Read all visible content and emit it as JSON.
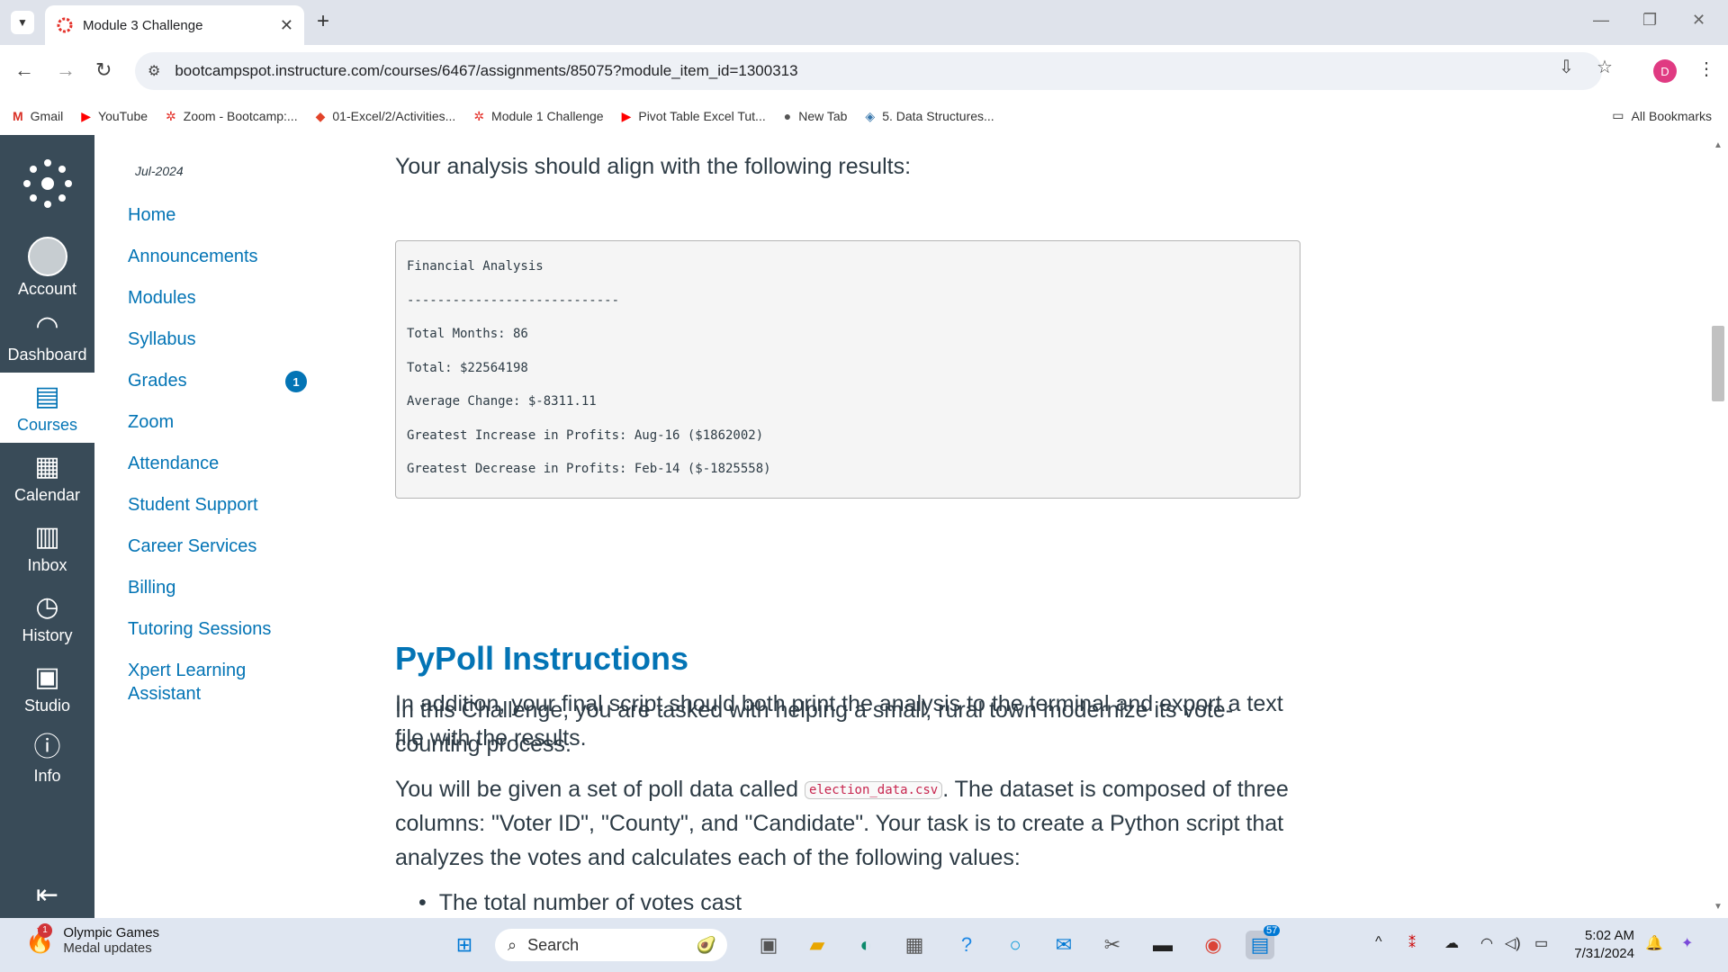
{
  "browser": {
    "tab_title": "Module 3 Challenge",
    "url": "bootcampspot.instructure.com/courses/6467/assignments/85075?module_item_id=1300313",
    "bookmarks": [
      {
        "label": "Gmail",
        "icon": "gmail-icon"
      },
      {
        "label": "YouTube",
        "icon": "youtube-icon"
      },
      {
        "label": "Zoom - Bootcamp:...",
        "icon": "canvas-icon"
      },
      {
        "label": "01-Excel/2/Activities...",
        "icon": "gitlab-icon"
      },
      {
        "label": "Module 1 Challenge",
        "icon": "canvas-icon"
      },
      {
        "label": "Pivot Table Excel Tut...",
        "icon": "youtube-icon"
      },
      {
        "label": "New Tab",
        "icon": "globe-icon"
      },
      {
        "label": "5. Data Structures...",
        "icon": "python-icon"
      }
    ],
    "all_bookmarks": "All Bookmarks",
    "profile_initial": "D"
  },
  "global_nav": {
    "items": [
      {
        "label": "Account"
      },
      {
        "label": "Dashboard"
      },
      {
        "label": "Courses"
      },
      {
        "label": "Calendar"
      },
      {
        "label": "Inbox"
      },
      {
        "label": "History"
      },
      {
        "label": "Studio"
      },
      {
        "label": "Info"
      }
    ]
  },
  "course_nav": {
    "term": "Jul-2024",
    "links": [
      {
        "label": "Home"
      },
      {
        "label": "Announcements"
      },
      {
        "label": "Modules"
      },
      {
        "label": "Syllabus"
      },
      {
        "label": "Grades"
      },
      {
        "label": "Zoom"
      },
      {
        "label": "Attendance"
      },
      {
        "label": "Student Support"
      },
      {
        "label": "Career Services"
      },
      {
        "label": "Billing"
      },
      {
        "label": "Tutoring Sessions"
      },
      {
        "label": "Xpert Learning"
      },
      {
        "label": "Assistant"
      }
    ],
    "grades_badge": "1"
  },
  "content": {
    "intro": "Your analysis should align with the following results:",
    "code_lines": [
      "Financial Analysis",
      "----------------------------",
      "Total Months: 86",
      "Total: $22564198",
      "Average Change: $-8311.11",
      "Greatest Increase in Profits: Aug-16 ($1862002)",
      "Greatest Decrease in Profits: Feb-14 ($-1825558)"
    ],
    "addition_line1": "In addition, your final script should both print the analysis to the terminal and export a text",
    "addition_line2": "file with the results.",
    "heading": "PyPoll Instructions",
    "pypoll_line1": "In this Challenge, you are tasked with helping a small, rural town modernize its vote-",
    "pypoll_line2": "counting process.",
    "data_pre": "You will be given a set of poll data called ",
    "data_code": "election_data.csv",
    "data_post": ". The dataset is composed of three",
    "data_line2": "columns: \"Voter ID\", \"County\", and \"Candidate\". Your task is to create a Python script that",
    "data_line3": "analyzes the votes and calculates each of the following values:",
    "bullet1": "The total number of votes cast"
  },
  "taskbar": {
    "news_title": "Olympic Games",
    "news_sub": "Medal updates",
    "news_badge": "1",
    "search_label": "Search",
    "store_badge": "57",
    "time": "5:02 AM",
    "date": "7/31/2024"
  }
}
